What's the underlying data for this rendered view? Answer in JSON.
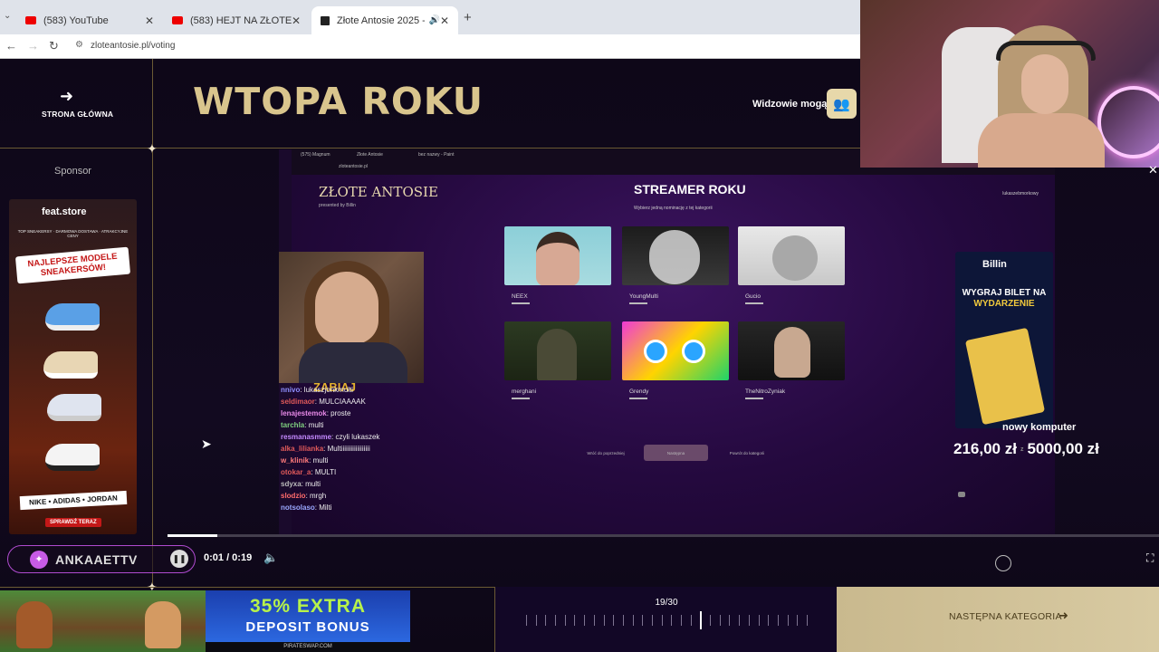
{
  "browser": {
    "tabs": [
      {
        "title": "(583) YouTube"
      },
      {
        "title": "(583) HEJT NA ZŁOTE ANTOSIE"
      },
      {
        "title": "Złote Antosie 2025 - Najwię"
      }
    ],
    "url": "zloteantosie.pl/voting"
  },
  "header": {
    "home_label": "STRONA GŁÓWNA",
    "title": "WTOPA ROKU",
    "viewers_label": "Widzowie mogą"
  },
  "sponsor": {
    "label": "Sponsor",
    "ad": {
      "brand": "feat.store",
      "topline": "TOP SNEAKERSY · DARMOWA DOSTAWA · ATRAKCYJNE CENY",
      "headline": "NAJLEPSZE MODELE SNEAKERSÓW!",
      "brands": "NIKE • ADIDAS • JORDAN",
      "cta": "SPRAWDŹ TERAZ"
    }
  },
  "video": {
    "inner_tabs": [
      "(575) Magnum",
      "Złote Antosie",
      "bez nazwy - Paint"
    ],
    "inner_url": "zloteantosie.pl",
    "logo": "ZŁOTE ANTOSIE",
    "logo_sub": "presented by Billin",
    "category": "STREAMER ROKU",
    "category_sub": "Wybierz jedną nominację z tej kategorii",
    "user": "lukaszebmorkowy",
    "nominees": [
      {
        "name": "NEEX"
      },
      {
        "name": "YoungMulti"
      },
      {
        "name": "Gucio"
      },
      {
        "name": "merghani"
      },
      {
        "name": "Grendy"
      },
      {
        "name": "TheNitroZyniak"
      }
    ],
    "buttons": [
      "Wróć do poprzedniej",
      "Następna",
      "Powrót do kategorii"
    ],
    "ad": {
      "brand": "Billin",
      "headline_1": "WYGRAJ BILET NA",
      "headline_2": "WYDARZENIE"
    },
    "webcam_label": "ZABIAJ",
    "chat": [
      {
        "user": "nnivo",
        "msg": "lukaszjonkmulti"
      },
      {
        "user": "seldimaor",
        "msg": "MULCIAAAAK"
      },
      {
        "user": "lenajestemok",
        "msg": "proste"
      },
      {
        "user": "tarchla",
        "msg": "multi"
      },
      {
        "user": "resmanasmme",
        "msg": "czyli lukaszek"
      },
      {
        "user": "alka_lilianka",
        "msg": "Multiiiiiiiiiiiiiiiiii"
      },
      {
        "user": "w_klinik",
        "msg": "multi"
      },
      {
        "user": "otokar_a",
        "msg": "MULTI"
      },
      {
        "user": "sdyxa",
        "msg": "multi"
      },
      {
        "user": "slodzio",
        "msg": "mrgh"
      },
      {
        "user": "notsolaso",
        "msg": "Milti"
      }
    ]
  },
  "donation": {
    "label": "nowy komputer",
    "current": "216,00 zł",
    "separator": "z",
    "goal": "5000,00 zł"
  },
  "player": {
    "channel": "ANKAAETTV",
    "time": "0:01 / 0:19",
    "progress": 0.05
  },
  "bottom": {
    "bonus_line1": "35% EXTRA",
    "bonus_line2": "DEPOSIT BONUS",
    "bonus_footer": "PIRATESWAP.COM",
    "pager": "19/30",
    "pager_current": 19,
    "pager_total": 30,
    "next_label": "NASTĘPNA KATEGORIA"
  },
  "colors": {
    "gold": "#d9c58d",
    "accent_purple": "#b04bd0",
    "next_bg": "#d8caa2"
  }
}
